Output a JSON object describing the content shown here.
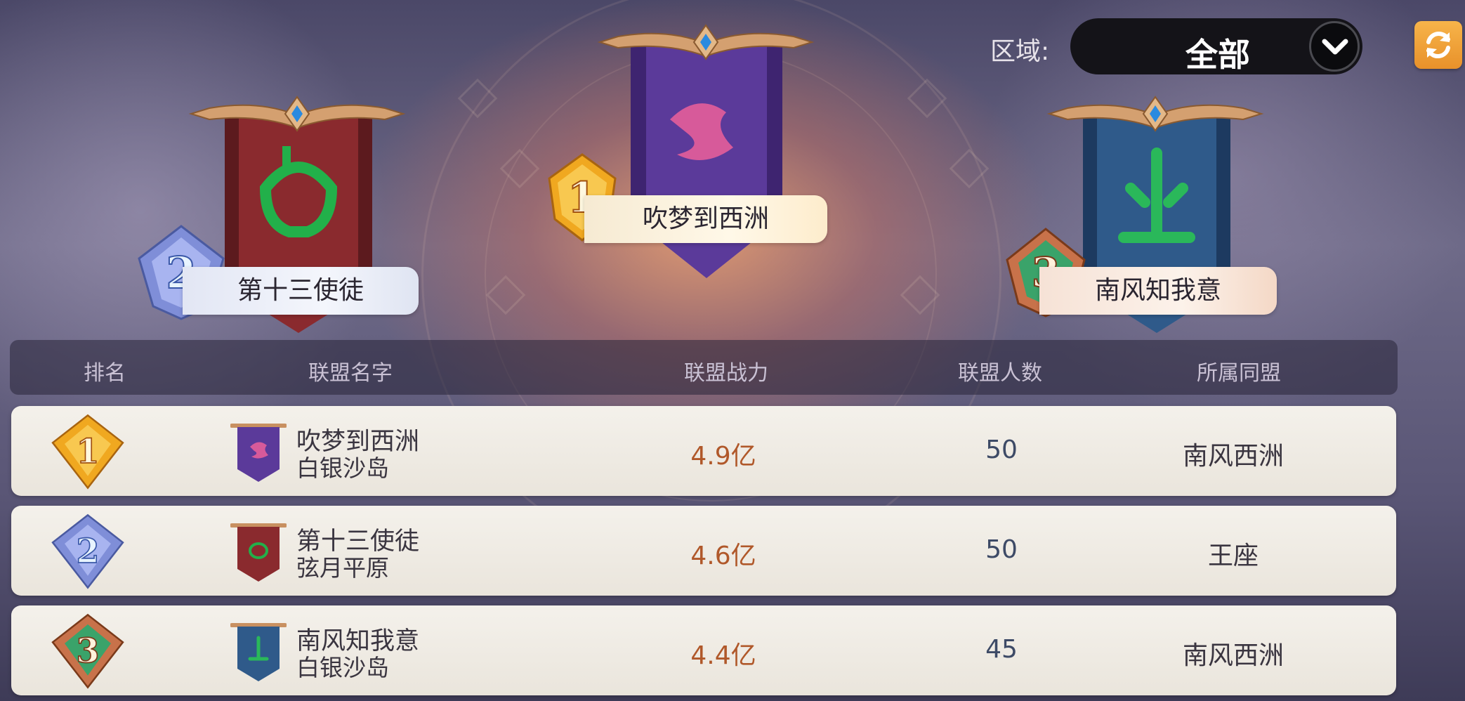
{
  "region": {
    "label": "区域:",
    "value": "全部"
  },
  "icons": {
    "refresh": "refresh-icon",
    "dropdown": "chevron-down-icon"
  },
  "podium": [
    {
      "rank": "1",
      "name": "吹梦到西洲",
      "banner_color": "#5b3a9a",
      "emblem_color": "#d75a9a"
    },
    {
      "rank": "2",
      "name": "第十三使徒",
      "banner_color": "#8a2a2e",
      "emblem_color": "#22b04a"
    },
    {
      "rank": "3",
      "name": "南风知我意",
      "banner_color": "#2f5a8a",
      "emblem_color": "#2ab85a"
    }
  ],
  "table": {
    "headers": [
      "排名",
      "联盟名字",
      "联盟战力",
      "联盟人数",
      "所属同盟"
    ],
    "rows": [
      {
        "rank": "1",
        "name": "吹梦到西洲",
        "server": "白银沙岛",
        "power": "4.9亿",
        "members": "50",
        "alliance": "南风西洲"
      },
      {
        "rank": "2",
        "name": "第十三使徒",
        "server": "弦月平原",
        "power": "4.6亿",
        "members": "50",
        "alliance": "王座"
      },
      {
        "rank": "3",
        "name": "南风知我意",
        "server": "白银沙岛",
        "power": "4.4亿",
        "members": "45",
        "alliance": "南风西洲"
      }
    ]
  },
  "colors": {
    "gold": "#f0a820",
    "silver": "#7f8ed8",
    "bronze": "#c8724a",
    "power": "#b0582a",
    "members": "#3d4a66"
  }
}
